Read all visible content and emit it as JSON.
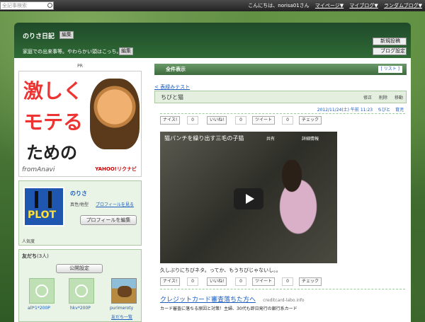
{
  "topbar": {
    "search_placeholder": "全記事検索",
    "greeting": "こんにちは、norisa01さん",
    "my_page": "マイページ▼",
    "my_blog": "マイブログ▼",
    "random_blog": "ランダムブログ▼"
  },
  "header": {
    "title": "のりさ日記",
    "edit_label": "編集",
    "description": "家庭での出来事等。やわらかい頭はこっち。",
    "new_post": "新規投稿",
    "blog_settings": "ブログ設定"
  },
  "sidebar": {
    "pr_label": "PR",
    "ad": {
      "line1": "激しく",
      "line2": "モテる",
      "line3": "ための",
      "brand": "fromAnavi",
      "sponsor": "YAHOO!リクナビ"
    },
    "profile": {
      "nickname": "のりさ",
      "logo_text": "PLOT",
      "meta": "真性/他型",
      "view_profile": "プロフィールを見る",
      "edit_profile": "プロフィールを編集",
      "popularity": "人気度"
    },
    "friends": {
      "title": "友だち",
      "count": "(3人)",
      "public_setting": "公開設定",
      "items": [
        "all*1*200P",
        "hkv*200P",
        "purimeroty"
      ],
      "list_link": "友だち一覧"
    }
  },
  "main": {
    "show_all": "全件表示",
    "list_label": "[ リスト ]",
    "back_link": "< 表緑みテスト",
    "entry": {
      "title": "ちびと猫",
      "tools": [
        "修正",
        "削除",
        "移動"
      ],
      "date": "2012/11/24(土) 午前 11:23",
      "category1": "ちびと",
      "category2": "育児",
      "social": {
        "nice": "ナイス!",
        "nice_count": "0",
        "like": "いいね!",
        "like_count": "0",
        "tweet": "ツイート",
        "tweet_count": "0",
        "check": "チェック"
      },
      "video_title": "猫パンチを繰り出す三毛の子猫",
      "video_share": "共有",
      "video_info": "詳細情報",
      "caption": "久しぶりにちびネタ。ってか、もうちびじゃないし。。"
    },
    "ad": {
      "title": "クレジットカード審査落ちた方へ",
      "domain": "creditcard-labo.info",
      "desc": "カード審査に落ちる原因と対策！主婦、30代も即日発行の銀行系カード"
    }
  }
}
